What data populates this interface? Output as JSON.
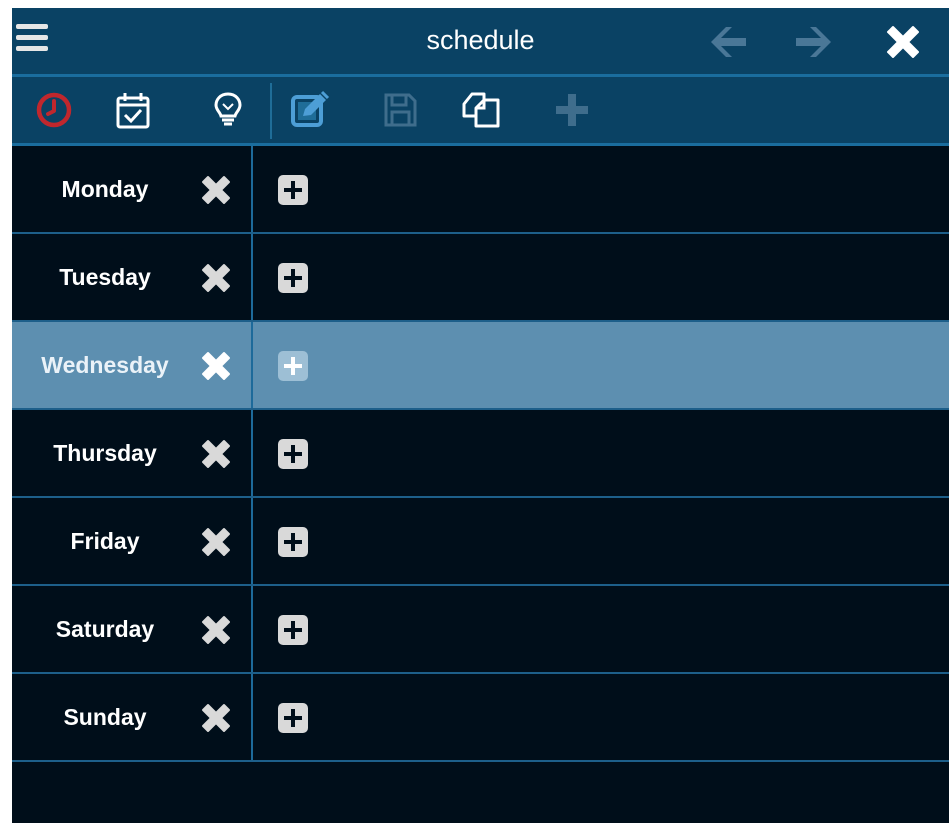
{
  "window": {
    "title": "schedule"
  },
  "titlebar": {
    "icons": {
      "menu": "hamburger-menu-icon",
      "back": "arrow-left-icon",
      "forward": "arrow-right-icon",
      "close": "close-x-icon"
    }
  },
  "toolbar": {
    "tools": [
      {
        "name": "clock-icon",
        "color": "#c0272d",
        "state": "enabled"
      },
      {
        "name": "calendar-check-icon",
        "color": "#ffffff",
        "state": "enabled"
      },
      {
        "name": "lightbulb-icon",
        "color": "#ffffff",
        "state": "enabled"
      },
      {
        "name": "edit-icon",
        "color": "#4d9ed6",
        "state": "active"
      },
      {
        "name": "save-icon",
        "color": "#3f6d8c",
        "state": "disabled"
      },
      {
        "name": "copy-icon",
        "color": "#ffffff",
        "state": "enabled"
      },
      {
        "name": "add-icon",
        "color": "#3f6d8c",
        "state": "disabled"
      }
    ]
  },
  "schedule": {
    "selected_day": "Wednesday",
    "days": [
      {
        "label": "Monday"
      },
      {
        "label": "Tuesday"
      },
      {
        "label": "Wednesday"
      },
      {
        "label": "Thursday"
      },
      {
        "label": "Friday"
      },
      {
        "label": "Saturday"
      },
      {
        "label": "Sunday"
      }
    ]
  },
  "colors": {
    "header_bg": "#0a4264",
    "body_bg": "#000e1a",
    "accent_border": "#1d6a9a",
    "selected_row": "#5d8fb0",
    "disabled_icon": "#3f6d8c",
    "clock_red": "#c0272d"
  }
}
